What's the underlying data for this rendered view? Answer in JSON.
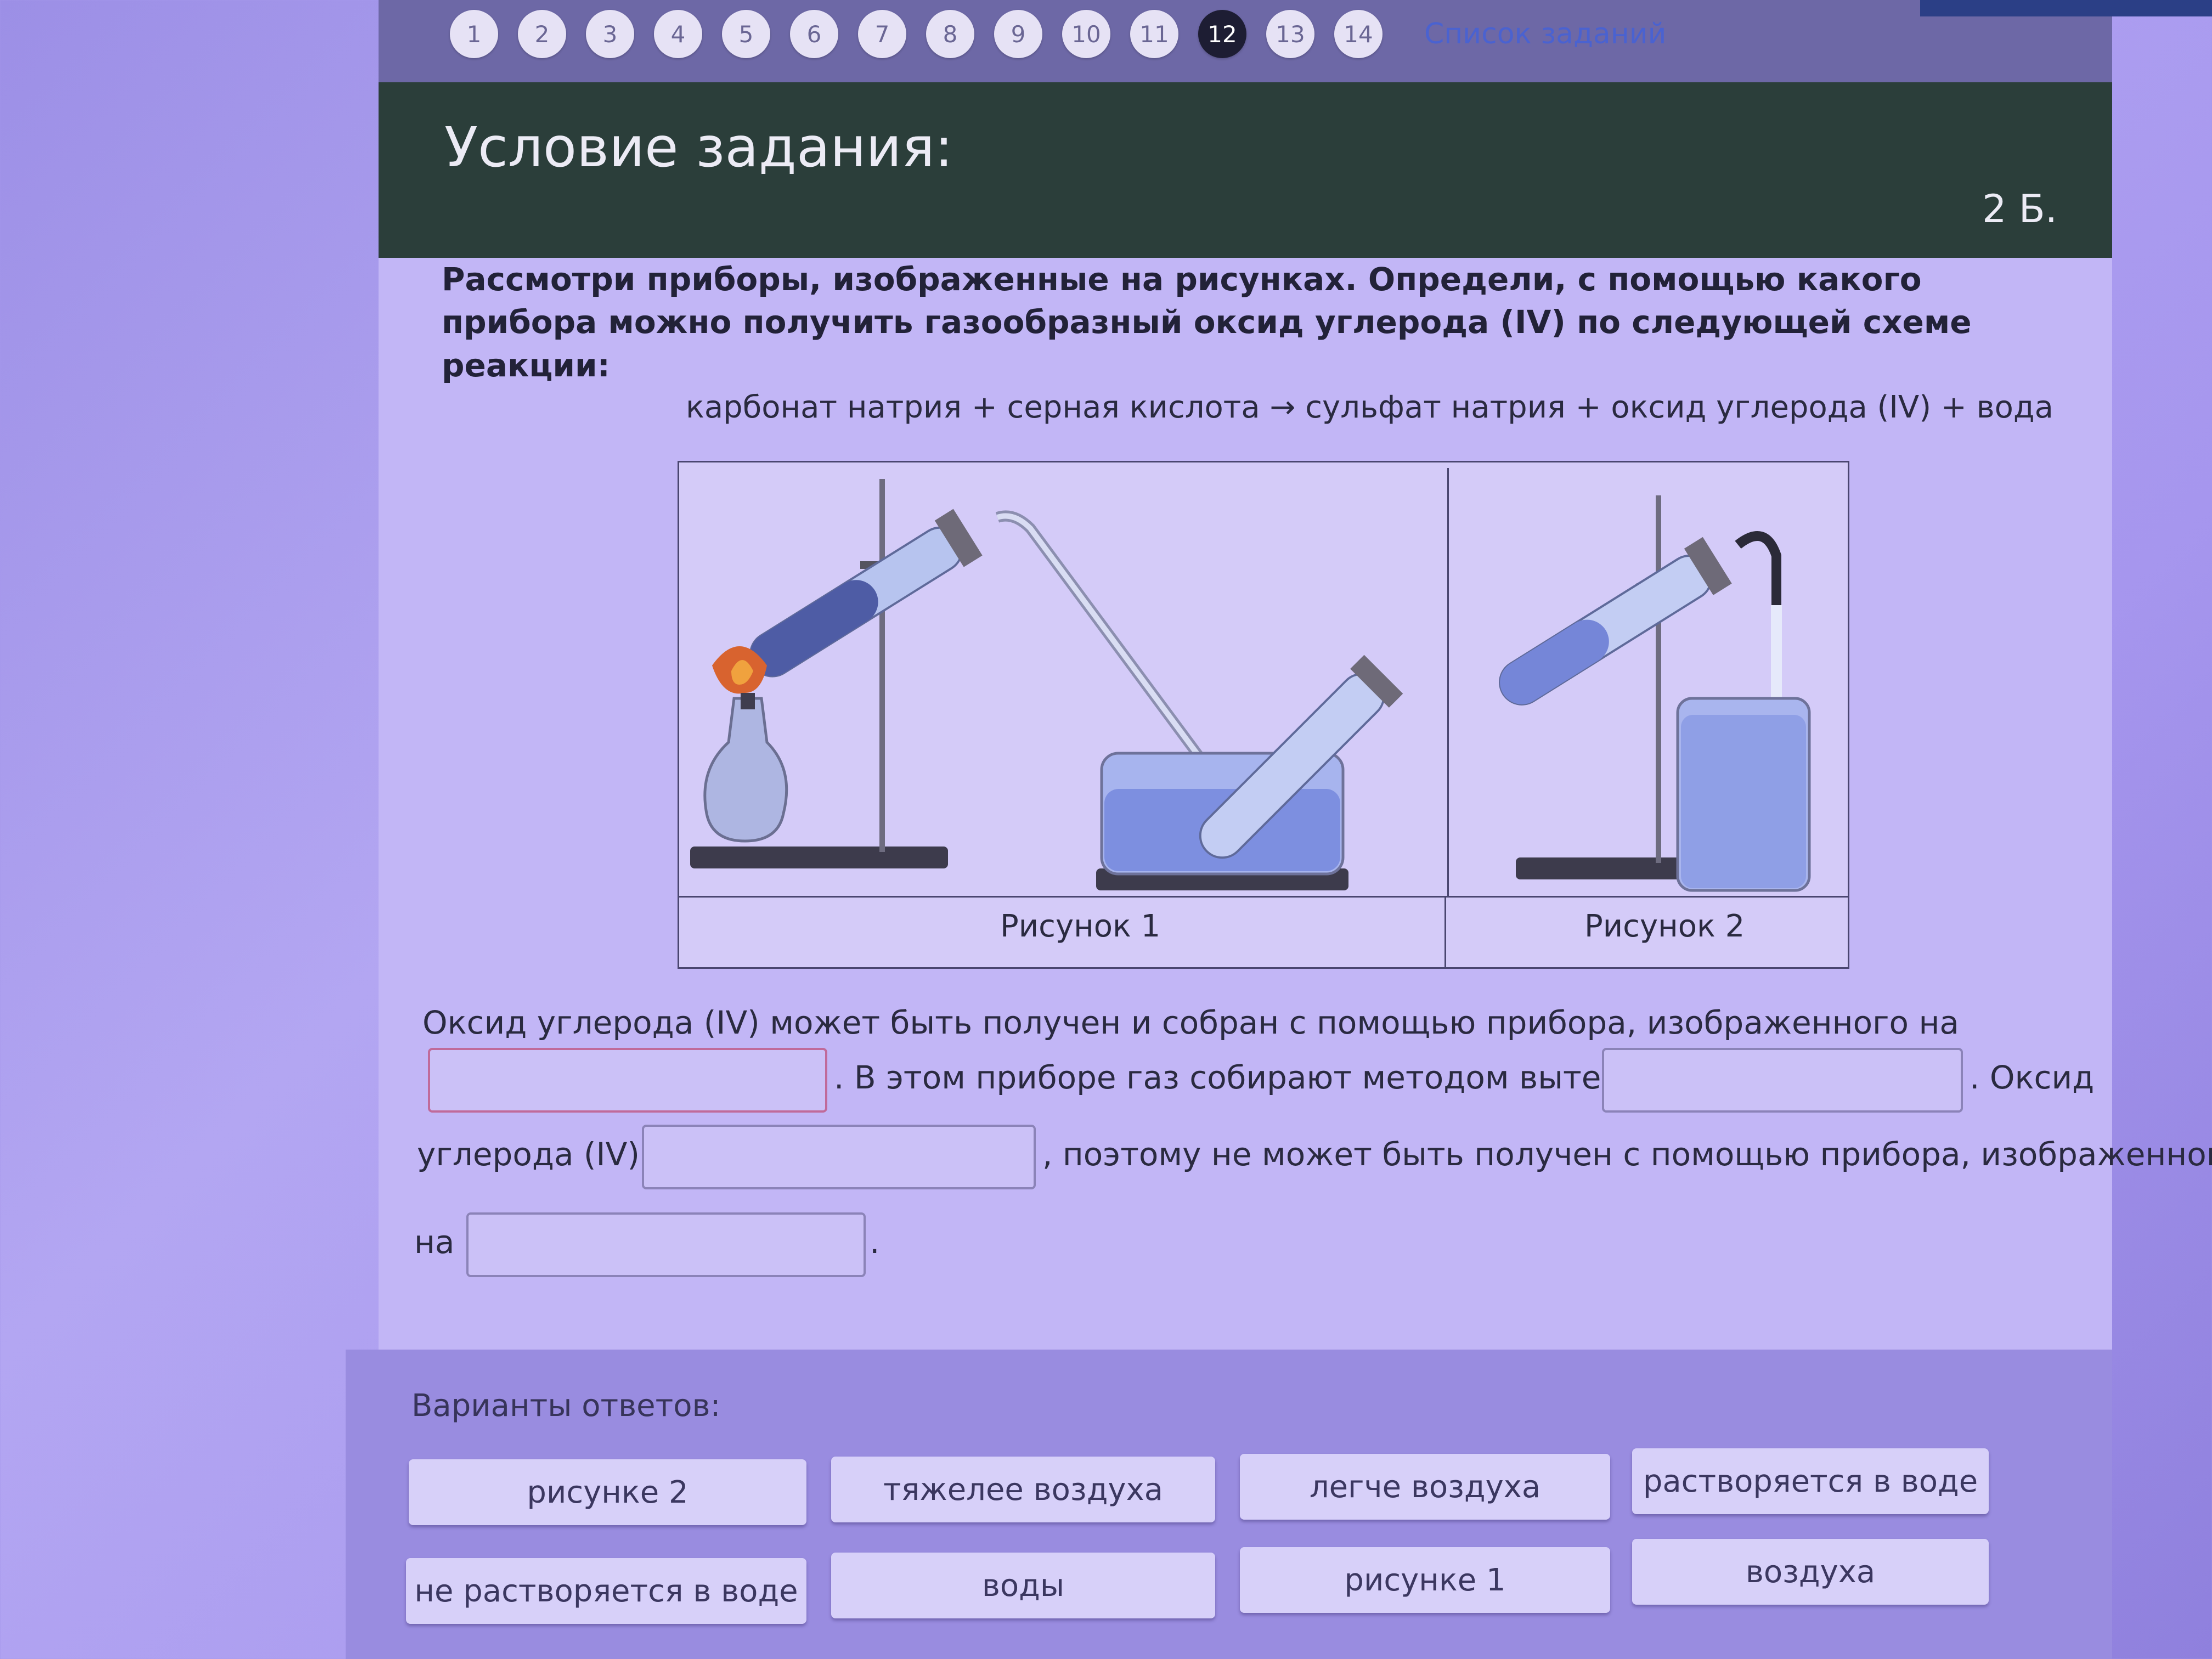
{
  "nav": {
    "items": [
      "1",
      "2",
      "3",
      "4",
      "5",
      "6",
      "7",
      "8",
      "9",
      "10",
      "11",
      "12",
      "13",
      "14"
    ],
    "active_index": 11,
    "list_link": "Список заданий"
  },
  "header": {
    "title": "Условие задания:",
    "points": "2 Б."
  },
  "task": {
    "question": "Рассмотри приборы, изображенные на рисунках. Определи, с помощью какого прибора можно получить газообразный оксид углерода (IV) по следующей схеме реакции:",
    "formula": "карбонат натрия + серная кислота → сульфат натрия + оксид углерода (IV) + вода",
    "figure1_caption": "Рисунок 1",
    "figure2_caption": "Рисунок 2"
  },
  "answer": {
    "part1": "Оксид углерода (IV) может быть получен и собран с помощью прибора, изображенного на",
    "part2": ". В этом приборе газ собирают методом вытеснения",
    "part3": ". Оксид",
    "part4": "углерода (IV)",
    "part5": ", поэтому не может быть получен с помощью прибора, изображенного",
    "part6": "на",
    "part7": "."
  },
  "options": {
    "label": "Варианты ответов:",
    "items": [
      "рисунке 2",
      "тяжелее воздуха",
      "легче воздуха",
      "растворяется в воде",
      "не растворяется в воде",
      "воды",
      "рисунке 1",
      "воздуха"
    ]
  },
  "colors": {
    "header_bg": "#2b3e3a",
    "card_bg": "#c2b6f6",
    "active_nav": "#1d1d33",
    "link": "#4a62d0"
  }
}
